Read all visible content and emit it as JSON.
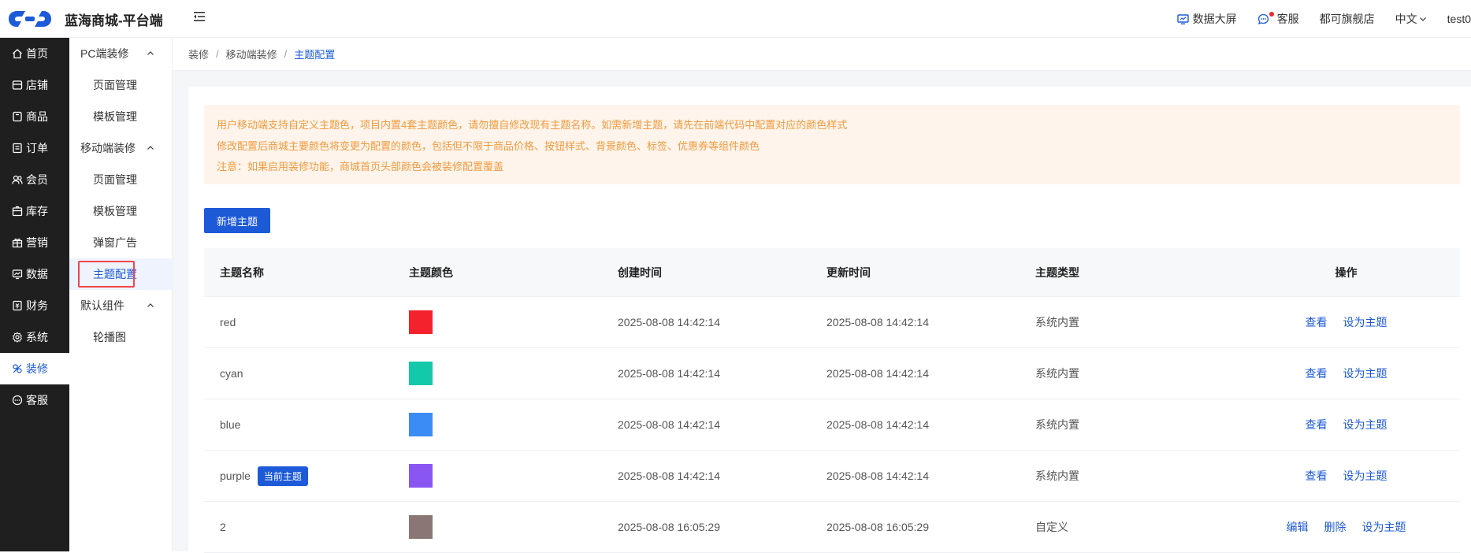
{
  "app": {
    "title": "蓝海商城-平台端"
  },
  "header": {
    "dashboard": "数据大屏",
    "service": "客服",
    "store": "都可旗舰店",
    "language": "中文",
    "user": "test0"
  },
  "nav": [
    {
      "label": "首页",
      "icon": "home-icon"
    },
    {
      "label": "店铺",
      "icon": "store-icon"
    },
    {
      "label": "商品",
      "icon": "goods-icon"
    },
    {
      "label": "订单",
      "icon": "order-icon"
    },
    {
      "label": "会员",
      "icon": "member-icon"
    },
    {
      "label": "库存",
      "icon": "stock-icon"
    },
    {
      "label": "营销",
      "icon": "gift-icon"
    },
    {
      "label": "数据",
      "icon": "data-icon"
    },
    {
      "label": "财务",
      "icon": "finance-icon"
    },
    {
      "label": "系统",
      "icon": "settings-icon"
    },
    {
      "label": "装修",
      "icon": "decorate-icon",
      "active": true
    },
    {
      "label": "客服",
      "icon": "chat-icon"
    }
  ],
  "subnav": {
    "group1": "PC端装修",
    "group1_items": [
      "页面管理",
      "模板管理"
    ],
    "group2": "移动端装修",
    "group2_items": [
      "页面管理",
      "模板管理",
      "弹窗广告",
      "主题配置"
    ],
    "group3": "默认组件",
    "group3_items": [
      "轮播图"
    ]
  },
  "breadcrumb": [
    "装修",
    "移动端装修",
    "主题配置"
  ],
  "notice": [
    "用户移动端支持自定义主题色，项目内置4套主题颜色，请勿擅自修改现有主题名称。如需新增主题，请先在前端代码中配置对应的颜色样式",
    "修改配置后商城主要颜色将变更为配置的颜色，包括但不限于商品价格、按钮样式、背景颜色、标签、优惠券等组件颜色",
    "注意：如果启用装修功能，商城首页头部颜色会被装修配置覆盖"
  ],
  "add_button": "新增主题",
  "table": {
    "headers": [
      "主题名称",
      "主题颜色",
      "创建时间",
      "更新时间",
      "主题类型",
      "操作"
    ],
    "current_badge": "当前主题",
    "rows": [
      {
        "name": "red",
        "color": "#f5222d",
        "created": "2025-08-08 14:42:14",
        "updated": "2025-08-08 14:42:14",
        "type": "系统内置",
        "actions": [
          "查看",
          "设为主题"
        ]
      },
      {
        "name": "cyan",
        "color": "#14c9a9",
        "created": "2025-08-08 14:42:14",
        "updated": "2025-08-08 14:42:14",
        "type": "系统内置",
        "actions": [
          "查看",
          "设为主题"
        ]
      },
      {
        "name": "blue",
        "color": "#3b8cf5",
        "created": "2025-08-08 14:42:14",
        "updated": "2025-08-08 14:42:14",
        "type": "系统内置",
        "actions": [
          "查看",
          "设为主题"
        ]
      },
      {
        "name": "purple",
        "color": "#8a56f3",
        "created": "2025-08-08 14:42:14",
        "updated": "2025-08-08 14:42:14",
        "type": "系统内置",
        "actions": [
          "查看",
          "设为主题"
        ],
        "current": true
      },
      {
        "name": "2",
        "color": "#8a7775",
        "created": "2025-08-08 16:05:29",
        "updated": "2025-08-08 16:05:29",
        "type": "自定义",
        "actions": [
          "编辑",
          "删除",
          "设为主题"
        ]
      }
    ]
  }
}
